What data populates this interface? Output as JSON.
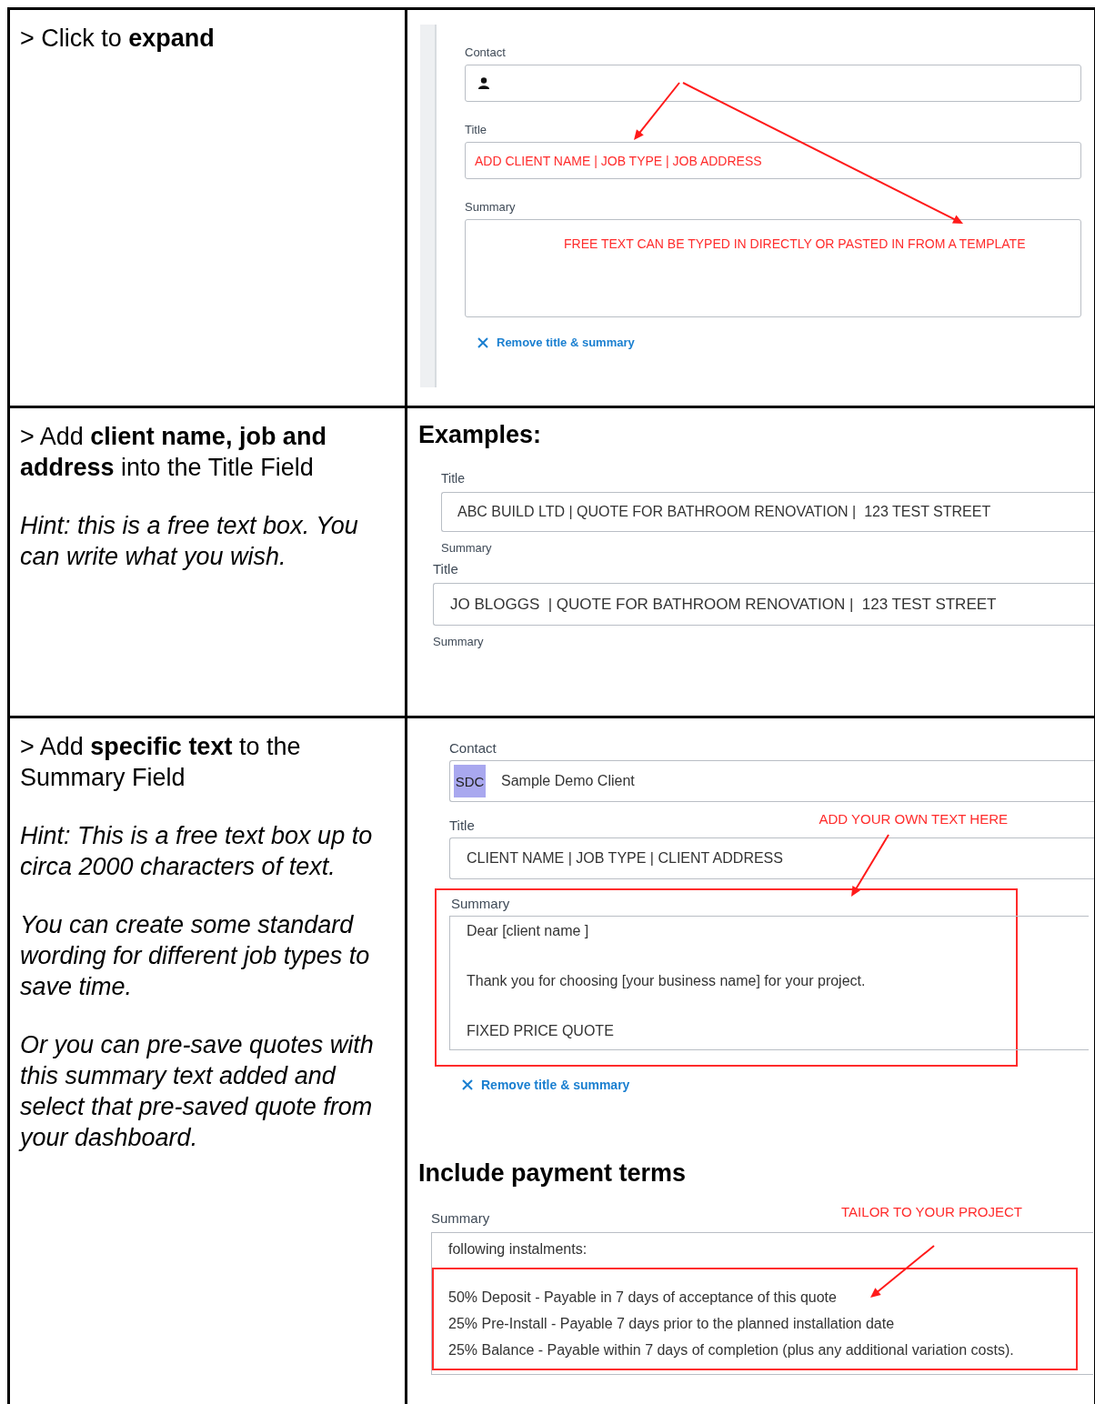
{
  "rows": [
    {
      "instructions": [
        {
          "kind": "plain",
          "text": "> Click to **expand**"
        }
      ],
      "panel": {
        "kind": "form",
        "contact_label": "Contact",
        "title_label": "Title",
        "title_value": "ADD CLIENT NAME | JOB TYPE | JOB ADDRESS",
        "summary_label": "Summary",
        "summary_value": "FREE TEXT CAN BE TYPED IN DIRECTLY OR PASTED IN FROM A TEMPLATE",
        "remove_link": "Remove title & summary"
      }
    },
    {
      "instructions": [
        {
          "kind": "plain",
          "text": "> Add **client name, job and address** into the Title Field"
        },
        {
          "kind": "hint",
          "text": "Hint: this is a free text box. You can write what you wish."
        }
      ],
      "panel": {
        "kind": "examples",
        "heading": "Examples:",
        "examples": [
          {
            "title_label": "Title",
            "value": "ABC BUILD LTD | QUOTE FOR BATHROOM RENOVATION |  123 TEST STREET",
            "summary_label": "Summary"
          },
          {
            "title_label": "Title",
            "value": "JO BLOGGS  | QUOTE FOR BATHROOM RENOVATION |  123 TEST STREET",
            "summary_label": "Summary"
          }
        ]
      }
    },
    {
      "instructions": [
        {
          "kind": "plain",
          "text": "> Add **specific text** to the Summary Field"
        },
        {
          "kind": "hint",
          "text": "Hint: This is a free text box up to circa 2000 characters of text."
        },
        {
          "kind": "hint",
          "text": "You can create some standard wording for different job types to save time."
        },
        {
          "kind": "hint",
          "text": "Or you can pre-save quotes with this summary text added and select that pre-saved quote from your dashboard."
        }
      ],
      "panel": {
        "kind": "summary_demo",
        "contact_label": "Contact",
        "initials": "SDC",
        "contact_name": "Sample Demo Client",
        "annotation": "ADD YOUR OWN TEXT HERE",
        "title_label": "Title",
        "title_value": "CLIENT NAME | JOB TYPE | CLIENT ADDRESS",
        "summary_label": "Summary",
        "summary_lines": [
          "Dear [client name ]",
          "Thank you for choosing [your business name] for your project.",
          "FIXED PRICE QUOTE"
        ],
        "remove_link": "Remove title & summary",
        "section_heading": "Include payment terms",
        "payment_label": "Summary",
        "payment_annotation": "TAILOR TO YOUR PROJECT",
        "payment_intro": "following instalments:",
        "payment_lines": [
          "50% Deposit - Payable in 7 days of acceptance of this quote",
          "25% Pre-Install - Payable 7 days prior to the planned installation date",
          "25% Balance - Payable within 7 days of completion (plus any additional variation costs)."
        ]
      }
    }
  ]
}
